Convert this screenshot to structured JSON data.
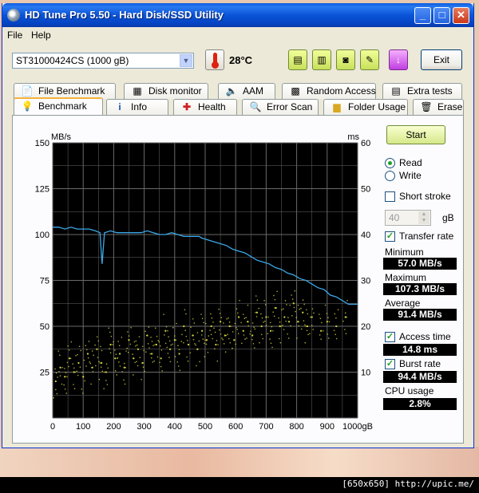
{
  "window": {
    "title": "HD Tune Pro 5.50 - Hard Disk/SSD Utility",
    "minimize": "_",
    "maximize": "□",
    "close": "✕"
  },
  "menu": {
    "file": "File",
    "help": "Help"
  },
  "toolbar": {
    "drive": "ST31000424CS (1000 gB)",
    "temperature": "28°C",
    "exit_label": "Exit",
    "icons": [
      "thermometer-icon",
      "copy-text-icon",
      "copy-screen-icon",
      "camera-icon",
      "options-icon",
      "save-icon"
    ]
  },
  "tabs_top": [
    {
      "label": "File Benchmark",
      "icon": "file-benchmark-icon"
    },
    {
      "label": "Disk monitor",
      "icon": "disk-monitor-icon"
    },
    {
      "label": "AAM",
      "icon": "speaker-icon"
    },
    {
      "label": "Random Access",
      "icon": "random-access-icon"
    },
    {
      "label": "Extra tests",
      "icon": "extra-tests-icon"
    }
  ],
  "tabs_bottom": [
    {
      "label": "Benchmark",
      "icon": "benchmark-icon",
      "active": true
    },
    {
      "label": "Info",
      "icon": "info-icon"
    },
    {
      "label": "Health",
      "icon": "health-icon"
    },
    {
      "label": "Error Scan",
      "icon": "error-scan-icon"
    },
    {
      "label": "Folder Usage",
      "icon": "folder-icon"
    },
    {
      "label": "Erase",
      "icon": "erase-icon"
    }
  ],
  "controls": {
    "start": "Start",
    "read": "Read",
    "write": "Write",
    "mode_selected": "Read",
    "short_stroke": "Short stroke",
    "short_stroke_checked": false,
    "stroke_value": "40",
    "stroke_unit": "gB",
    "transfer_rate": "Transfer rate",
    "transfer_rate_checked": true,
    "minimum_label": "Minimum",
    "minimum": "57.0 MB/s",
    "maximum_label": "Maximum",
    "maximum": "107.3 MB/s",
    "average_label": "Average",
    "average": "91.4 MB/s",
    "access_time": "Access time",
    "access_time_checked": true,
    "access_time_value": "14.8 ms",
    "burst_rate": "Burst rate",
    "burst_rate_checked": true,
    "burst_rate_value": "94.4 MB/s",
    "cpu_label": "CPU usage",
    "cpu_value": "2.8%"
  },
  "colors": {
    "chart_bg": "#000000",
    "grid": "#6a6a6a",
    "transfer_line": "#3ba8e8",
    "access_dots": "#d8d840"
  },
  "watermark": "[650x650] http://upic.me/",
  "chart_data": {
    "type": "line",
    "y_left_label": "MB/s",
    "y_right_label": "ms",
    "ylim": [
      0,
      150
    ],
    "y2lim": [
      0,
      60
    ],
    "xlim": [
      0,
      1000
    ],
    "x_ticks": [
      "0",
      "100",
      "200",
      "300",
      "400",
      "500",
      "600",
      "700",
      "800",
      "900",
      "1000gB"
    ],
    "y_ticks": [
      "150",
      "125",
      "100",
      "75",
      "50",
      "25"
    ],
    "y2_ticks": [
      "60",
      "50",
      "40",
      "30",
      "20",
      "10"
    ],
    "grid": true,
    "series": [
      {
        "type": "line",
        "x": [
          0,
          20,
          40,
          60,
          80,
          100,
          120,
          140,
          155,
          162,
          170,
          190,
          210,
          230,
          250,
          270,
          290,
          310,
          330,
          350,
          370,
          390,
          410,
          430,
          450,
          470,
          480,
          490,
          510,
          530,
          550,
          570,
          590,
          610,
          630,
          650,
          670,
          690,
          710,
          730,
          750,
          770,
          790,
          810,
          830,
          850,
          870,
          890,
          910,
          930,
          950,
          970,
          990,
          1000
        ],
        "y": [
          104,
          104,
          103,
          104,
          103,
          103,
          103,
          102,
          101,
          84,
          101,
          102,
          101,
          101,
          101,
          101,
          101,
          102,
          101,
          100,
          100,
          101,
          100,
          99,
          99,
          99,
          99,
          98,
          97,
          96,
          95,
          94,
          92,
          91,
          90,
          88,
          86,
          85,
          84,
          82,
          81,
          79,
          78,
          76,
          75,
          73,
          71,
          70,
          67,
          66,
          64,
          62,
          62,
          62
        ]
      },
      {
        "type": "scatter",
        "axis": "right",
        "x": [
          10,
          25,
          40,
          55,
          70,
          85,
          100,
          115,
          130,
          145,
          160,
          175,
          190,
          205,
          220,
          235,
          250,
          265,
          280,
          295,
          310,
          325,
          340,
          355,
          370,
          385,
          400,
          415,
          430,
          445,
          460,
          475,
          490,
          505,
          520,
          535,
          550,
          565,
          580,
          595,
          610,
          625,
          640,
          655,
          670,
          685,
          700,
          715,
          730,
          745,
          760,
          775,
          790,
          805,
          820,
          835,
          850,
          880,
          900,
          930,
          960
        ],
        "y": [
          8,
          11,
          9,
          13,
          10,
          12,
          9,
          14,
          11,
          15,
          12,
          10,
          16,
          13,
          14,
          11,
          17,
          13,
          15,
          12,
          18,
          14,
          16,
          13,
          19,
          15,
          17,
          14,
          20,
          16,
          18,
          15,
          19,
          17,
          20,
          16,
          21,
          18,
          20,
          17,
          22,
          19,
          21,
          18,
          23,
          20,
          22,
          19,
          24,
          20,
          22,
          21,
          25,
          21,
          23,
          20,
          22,
          19,
          21,
          20,
          22
        ]
      }
    ]
  }
}
